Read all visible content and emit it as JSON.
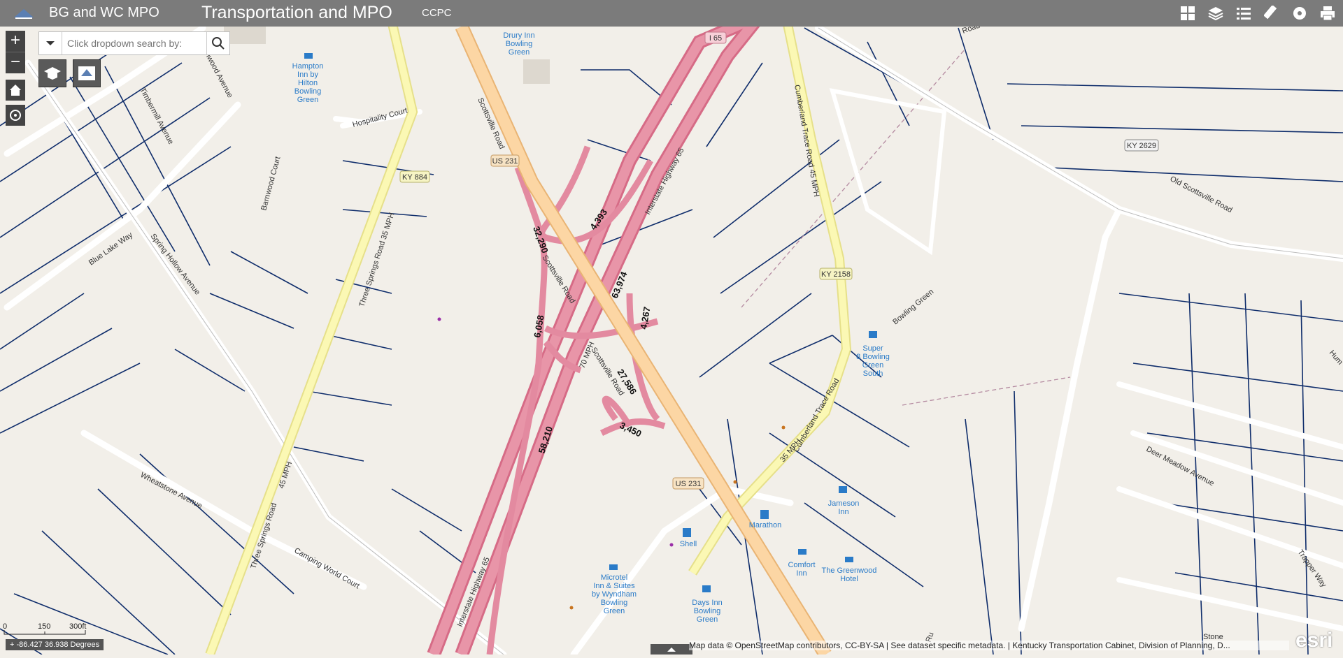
{
  "header": {
    "app_title": "BG and WC MPO",
    "page_title": "Transportation and MPO",
    "sub_title": "CCPC",
    "tools": [
      "dashboard-icon",
      "layers-icon",
      "legend-icon",
      "measure-icon",
      "film-icon",
      "print-icon"
    ]
  },
  "search": {
    "placeholder": "Click dropdown search by:"
  },
  "zoom": {
    "in": "+",
    "out": "−"
  },
  "scale": {
    "t0": "0",
    "t1": "150",
    "t2": "300ft"
  },
  "coordinates": "-86.427 36.938 Degrees",
  "attribution": "Map data © OpenStreetMap contributors, CC-BY-SA | See dataset specific metadata. | Kentucky Transportation Cabinet, Division of Planning, D...",
  "esri": "esri",
  "map": {
    "poi": {
      "drury": [
        "Drury Inn",
        "Bowling",
        "Green"
      ],
      "hampton": [
        "Hampton",
        "Inn by",
        "Hilton",
        "Bowling",
        "Green"
      ],
      "super8": [
        "Super",
        "8 Bowling",
        "Green",
        "South"
      ],
      "jameson": [
        "Jameson",
        "Inn"
      ],
      "marathon": "Marathon",
      "shell": "Shell",
      "comfort": [
        "Comfort",
        "Inn"
      ],
      "greenwood": [
        "The Greenwood",
        "Hotel"
      ],
      "days": [
        "Days Inn",
        "Bowling",
        "Green"
      ],
      "microtel": [
        "Microtel",
        "Inn & Suites",
        "by Wyndham",
        "Bowling",
        "Green"
      ]
    },
    "roads": {
      "scottsville1": "Scottsville Road",
      "scottsville2": "Scottsville Road",
      "scottsville3": "Scottsville Road",
      "us231a": "US 231",
      "us231b": "US 231",
      "i65": "I 65",
      "interstate1": "Interstate Highway 65",
      "interstate2": "Interstate Highway 65",
      "cumberland1": "Cumberland Trace Road 45 MPH",
      "cumberland2": "35 MPH",
      "cumberland3": "Cumberland Trace Road",
      "ky2158": "KY 2158",
      "ky884": "KY 884",
      "ky2629": "KY 2629",
      "threesprings1": "Three Springs Road 35 MPH",
      "threesprings2": "45 MPH",
      "threesprings3": "Three Springs Road",
      "hospitality": "Hospitality Court",
      "barnwood": "Barnwood Court",
      "timbermill": "Timbermill Avenue",
      "barnwoodave": "Barnwood Avenue",
      "bluelake": "Blue Lake Way",
      "springhollow": "Spring Hollow Avenue",
      "wheatstone": "Wheatstone Avenue",
      "campingworld": "Camping World Court",
      "oldscottsville": "Old Scottsville Road",
      "deermeadow": "Deer Meadow Avenue",
      "trapper": "Trapper Way",
      "bowlinggreen": "Bowling Green",
      "road_top": "Road",
      "speed70": "70 MPH",
      "stone": "Stone",
      "hum": "Hum",
      "ru": "Ru"
    },
    "counts": {
      "c1": "4,393",
      "c2": "32,290",
      "c3": "63,974",
      "c4": "6,058",
      "c5": "4,267",
      "c6": "27,586",
      "c7": "3,450",
      "c8": "58,210"
    }
  }
}
